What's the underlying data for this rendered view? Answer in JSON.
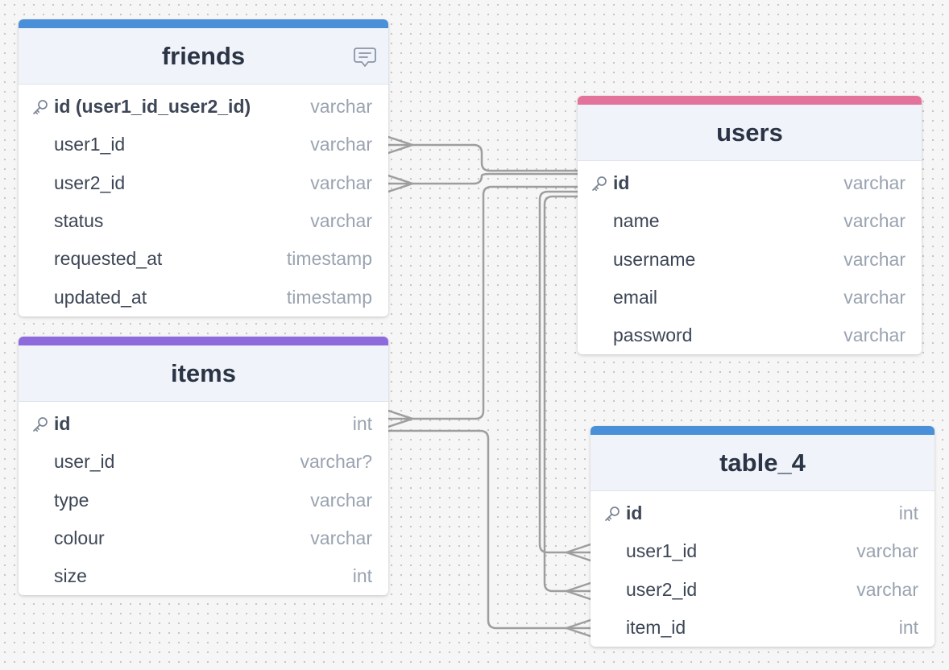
{
  "diagram": {
    "tables": [
      {
        "id": "friends",
        "name": "friends",
        "accent": "#4a90d9",
        "has_note": true,
        "columns": [
          {
            "name": "id (user1_id_user2_id)",
            "type": "varchar",
            "pk": true
          },
          {
            "name": "user1_id",
            "type": "varchar",
            "pk": false
          },
          {
            "name": "user2_id",
            "type": "varchar",
            "pk": false
          },
          {
            "name": "status",
            "type": "varchar",
            "pk": false
          },
          {
            "name": "requested_at",
            "type": "timestamp",
            "pk": false
          },
          {
            "name": "updated_at",
            "type": "timestamp",
            "pk": false
          }
        ]
      },
      {
        "id": "items",
        "name": "items",
        "accent": "#8e6bdc",
        "has_note": false,
        "columns": [
          {
            "name": "id",
            "type": "int",
            "pk": true
          },
          {
            "name": "user_id",
            "type": "varchar?",
            "pk": false
          },
          {
            "name": "type",
            "type": "varchar",
            "pk": false
          },
          {
            "name": "colour",
            "type": "varchar",
            "pk": false
          },
          {
            "name": "size",
            "type": "int",
            "pk": false
          }
        ]
      },
      {
        "id": "users",
        "name": "users",
        "accent": "#e3739a",
        "has_note": false,
        "columns": [
          {
            "name": "id",
            "type": "varchar",
            "pk": true
          },
          {
            "name": "name",
            "type": "varchar",
            "pk": false
          },
          {
            "name": "username",
            "type": "varchar",
            "pk": false
          },
          {
            "name": "email",
            "type": "varchar",
            "pk": false
          },
          {
            "name": "password",
            "type": "varchar",
            "pk": false
          }
        ]
      },
      {
        "id": "table_4",
        "name": "table_4",
        "accent": "#4a90d9",
        "has_note": false,
        "columns": [
          {
            "name": "id",
            "type": "int",
            "pk": true
          },
          {
            "name": "user1_id",
            "type": "varchar",
            "pk": false
          },
          {
            "name": "user2_id",
            "type": "varchar",
            "pk": false
          },
          {
            "name": "item_id",
            "type": "int",
            "pk": false
          }
        ]
      }
    ],
    "relations": [
      {
        "from_table": "friends",
        "from_column": "user1_id",
        "to_table": "users",
        "to_column": "id",
        "cardinality": "many-to-one"
      },
      {
        "from_table": "friends",
        "from_column": "user2_id",
        "to_table": "users",
        "to_column": "id",
        "cardinality": "many-to-one"
      },
      {
        "from_table": "items",
        "from_column": "id",
        "to_table": "users",
        "to_column": "id",
        "cardinality": "many-to-one"
      },
      {
        "from_table": "table_4",
        "from_column": "user1_id",
        "to_table": "users",
        "to_column": "id",
        "cardinality": "many-to-one"
      },
      {
        "from_table": "table_4",
        "from_column": "user2_id",
        "to_table": "users",
        "to_column": "id",
        "cardinality": "many-to-one"
      },
      {
        "from_table": "table_4",
        "from_column": "item_id",
        "to_table": "items",
        "to_column": "id",
        "cardinality": "many-to-one"
      }
    ],
    "colors": {
      "line": "#9e9e9e",
      "header_bg": "#f0f4fa",
      "title_text": "#2b3445",
      "column_text": "#3d4656",
      "type_text": "#9aa3b1"
    }
  }
}
